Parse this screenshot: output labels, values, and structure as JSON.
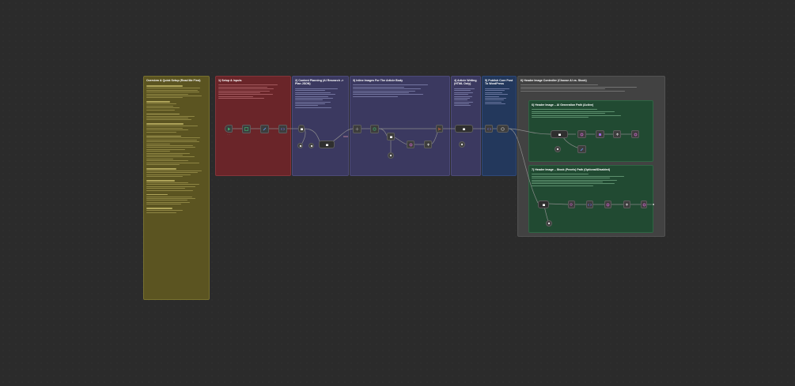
{
  "notes": {
    "overview": {
      "title": "Overview & Quick Setup (Read Me First)"
    },
    "setup": {
      "title": "1) Setup & Inputs"
    },
    "content": {
      "title": "2) Content Planning (AI Research -> Plan JSON)"
    },
    "inline": {
      "title": "3) Inline Images For The Article Body"
    },
    "writing": {
      "title": "4) Article Writing (HTML Only)"
    },
    "publish": {
      "title": "5) Publish Core Post To WordPress"
    },
    "header": {
      "title": "6) Header Image Controller (Choose AI vs. Stock)"
    },
    "ai_path": {
      "title": "6) Header Image – AI Generation Path (Active)"
    },
    "stock_path": {
      "title": "7) Header Image – Stock (Pexels) Path (Optional/Disabled)"
    }
  },
  "nodes": {
    "setup_trigger": {
      "icon": "play-icon",
      "color": "#3fa56a"
    },
    "setup_form": {
      "icon": "form-icon",
      "color": "#3fa56a"
    },
    "setup_set": {
      "icon": "edit-icon",
      "color": "#5b8fd9"
    },
    "setup_code": {
      "icon": "code-icon",
      "color": "#6e6ee0"
    },
    "ai_agent": {
      "icon": "robot-icon",
      "color": "#ffffff"
    },
    "ai_agent_2": {
      "icon": "robot-icon",
      "color": "#ffffff"
    },
    "loop": {
      "icon": "loop-icon",
      "color": "#3fa56a"
    },
    "inline_merge": {
      "icon": "merge-icon",
      "color": "#6e6ee0"
    },
    "wp_post": {
      "icon": "wordpress-icon",
      "color": "#cccccc"
    },
    "http": {
      "icon": "http-icon",
      "color": "#cc66cc"
    }
  }
}
